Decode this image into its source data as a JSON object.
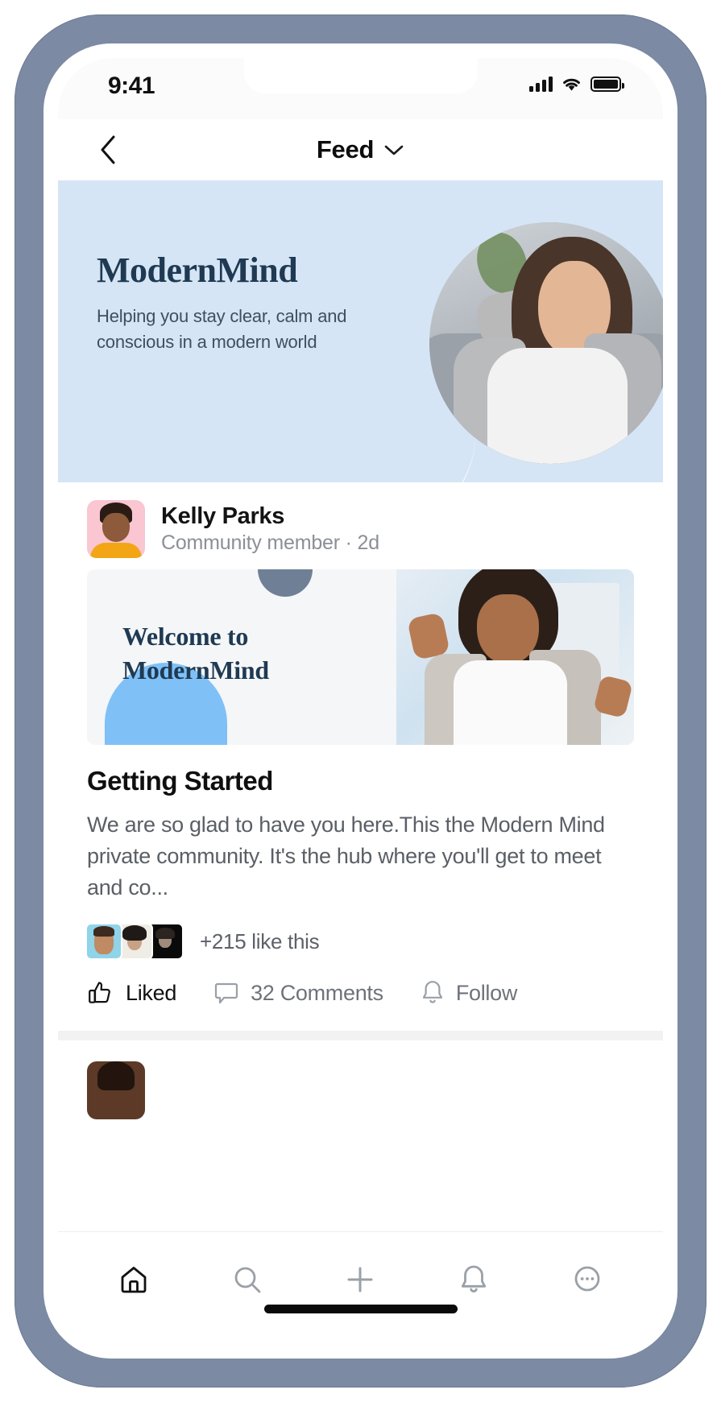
{
  "status_bar": {
    "time": "9:41",
    "cellular_icon": "signal-bars-icon",
    "wifi_icon": "wifi-icon",
    "battery_icon": "battery-full-icon"
  },
  "nav_header": {
    "back_icon": "chevron-left-icon",
    "title": "Feed",
    "chevron_icon": "chevron-down-icon"
  },
  "hero_banner": {
    "title": "ModernMind",
    "subtitle": "Helping you stay clear, calm and conscious in a modern world",
    "bg_color": "#d5e5f5",
    "title_color": "#1f3a52",
    "photo_alt": "woman-relaxing-on-couch-photo"
  },
  "post": {
    "author": {
      "name": "Kelly Parks",
      "role": "Community member",
      "separator": "·",
      "timestamp": "2d",
      "avatar_alt": "kelly-parks-avatar"
    },
    "card_image": {
      "title_line1": "Welcome to",
      "title_line2": "ModernMind",
      "bg_color": "#f4f6f8",
      "title_color": "#1f3a52",
      "accent_top_color": "#6f7f96",
      "accent_bottom_color": "#7fc0f7",
      "photo_alt": "woman-waving-hello-photo"
    },
    "heading": "Getting Started",
    "body": "We are so glad to have you here.This the Modern Mind private community. It's the hub where you'll get to meet and co...",
    "likes": {
      "text": "+215 like this",
      "avatars": [
        "liker-avatar-1",
        "liker-avatar-2",
        "liker-avatar-3"
      ]
    },
    "actions": [
      {
        "id": "like",
        "icon": "thumbs-up-icon",
        "label": "Liked",
        "active": true
      },
      {
        "id": "comments",
        "icon": "comment-bubble-icon",
        "label": "32 Comments",
        "active": false
      },
      {
        "id": "follow",
        "icon": "bell-icon",
        "label": "Follow",
        "active": false
      }
    ]
  },
  "bottom_nav": {
    "items": [
      {
        "id": "home",
        "icon": "home-icon",
        "active": true
      },
      {
        "id": "search",
        "icon": "search-icon",
        "active": false
      },
      {
        "id": "create",
        "icon": "plus-icon",
        "active": false
      },
      {
        "id": "notifications",
        "icon": "bell-icon",
        "active": false
      },
      {
        "id": "messages",
        "icon": "chat-bubble-icon",
        "active": false
      }
    ]
  }
}
